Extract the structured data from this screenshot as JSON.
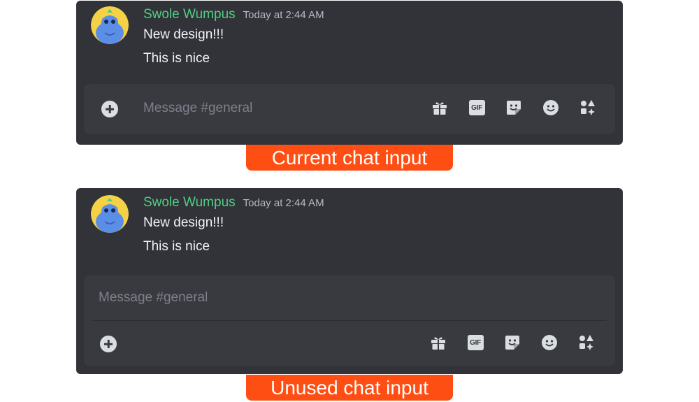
{
  "examples": [
    {
      "message": {
        "username": "Swole Wumpus",
        "timestamp": "Today at 2:44 AM",
        "lines": [
          "New design!!!",
          "This is nice"
        ]
      },
      "input": {
        "placeholder": "Message #general",
        "layout": "single-row"
      },
      "caption": "Current chat input"
    },
    {
      "message": {
        "username": "Swole Wumpus",
        "timestamp": "Today at 2:44 AM",
        "lines": [
          "New design!!!",
          "This is nice"
        ]
      },
      "input": {
        "placeholder": "Message #general",
        "layout": "two-row"
      },
      "caption": "Unused chat input"
    }
  ],
  "actions": [
    {
      "icon": "gift-icon"
    },
    {
      "icon": "gif-icon",
      "text": "GIF"
    },
    {
      "icon": "sticker-icon"
    },
    {
      "icon": "emoji-icon"
    },
    {
      "icon": "apps-icon"
    }
  ],
  "colors": {
    "panel_bg": "#313338",
    "input_bg": "#383a40",
    "username": "#4fcf82",
    "timestamp": "#b5bac1",
    "message_text": "#f2f3f5",
    "placeholder": "#7d8089",
    "icon": "#dbdee1",
    "caption_bg": "#ff4e14",
    "caption_text": "#ffffff"
  }
}
